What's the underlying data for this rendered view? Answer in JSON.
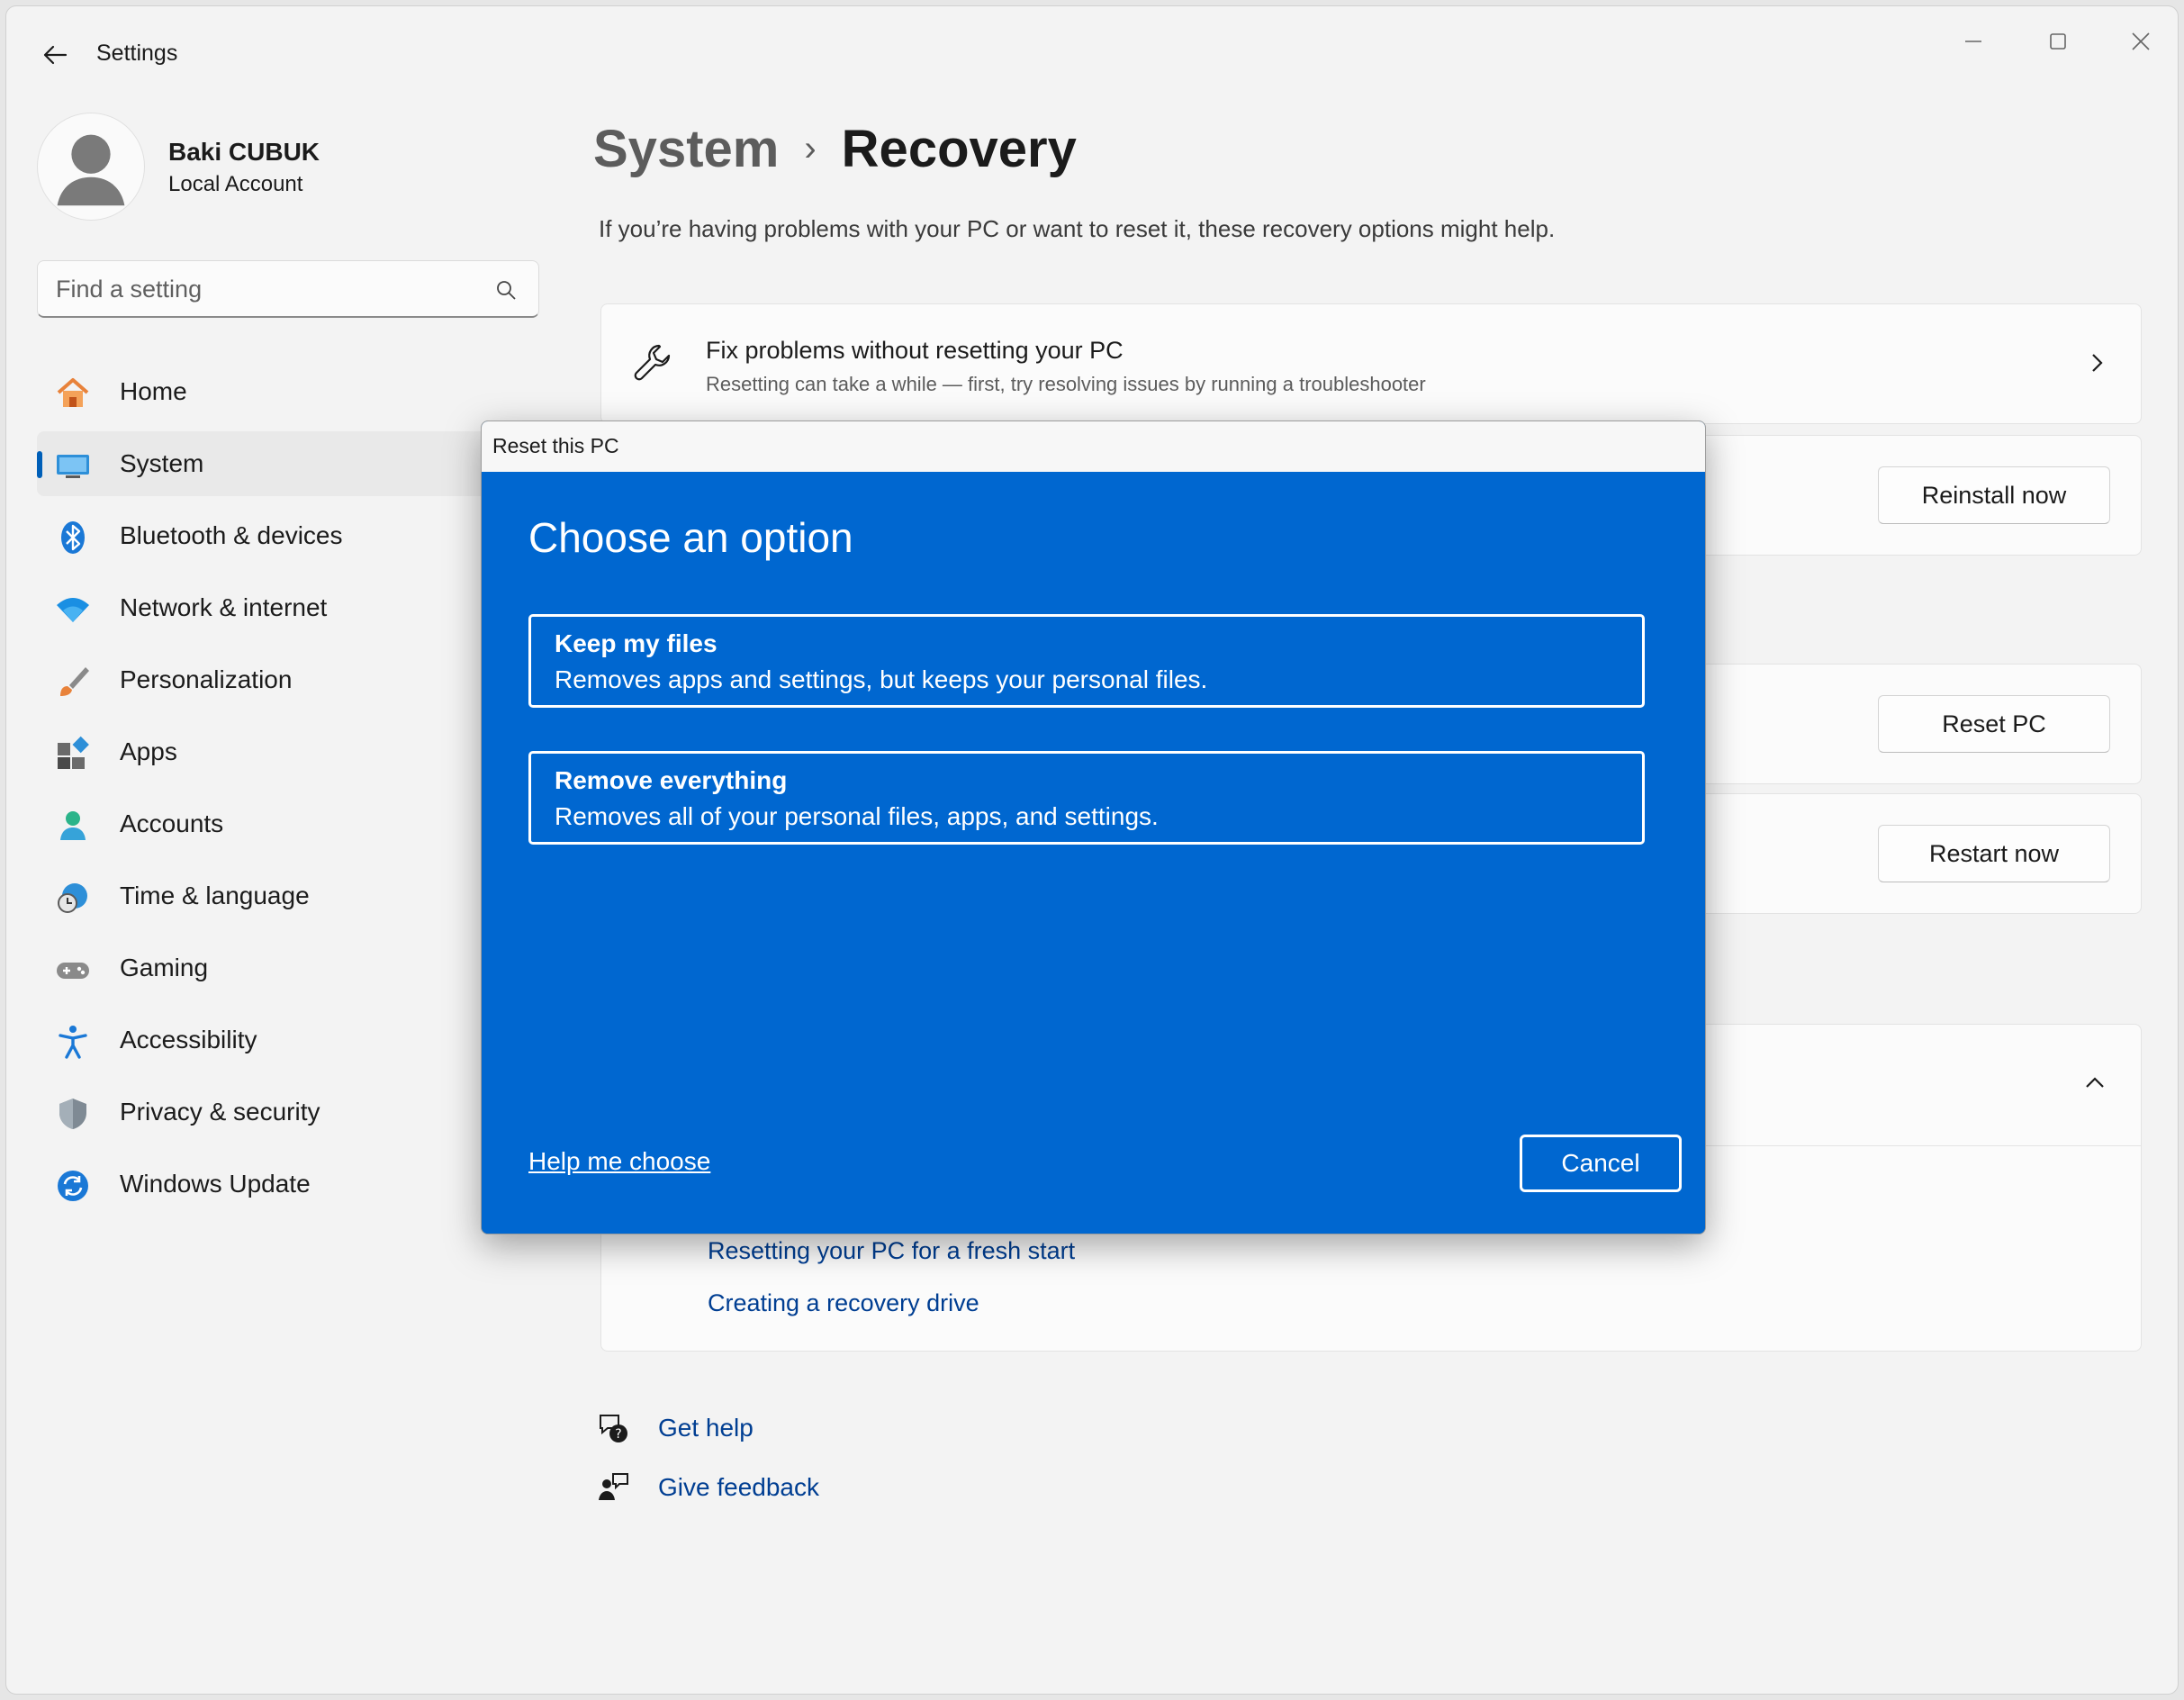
{
  "app": {
    "title": "Settings"
  },
  "profile": {
    "name": "Baki CUBUK",
    "account_type": "Local Account"
  },
  "search": {
    "placeholder": "Find a setting"
  },
  "sidebar": {
    "items": [
      {
        "label": "Home",
        "icon": "home-icon"
      },
      {
        "label": "System",
        "icon": "system-icon",
        "selected": true
      },
      {
        "label": "Bluetooth & devices",
        "icon": "bluetooth-icon"
      },
      {
        "label": "Network & internet",
        "icon": "wifi-icon"
      },
      {
        "label": "Personalization",
        "icon": "brush-icon"
      },
      {
        "label": "Apps",
        "icon": "apps-icon"
      },
      {
        "label": "Accounts",
        "icon": "accounts-icon"
      },
      {
        "label": "Time & language",
        "icon": "time-language-icon"
      },
      {
        "label": "Gaming",
        "icon": "gaming-icon"
      },
      {
        "label": "Accessibility",
        "icon": "accessibility-icon"
      },
      {
        "label": "Privacy & security",
        "icon": "shield-icon"
      },
      {
        "label": "Windows Update",
        "icon": "update-icon"
      }
    ]
  },
  "main": {
    "breadcrumb_parent": "System",
    "breadcrumb_current": "Recovery",
    "description": "If you’re having problems with your PC or want to reset it, these recovery options might help.",
    "fix_card": {
      "title": "Fix problems without resetting your PC",
      "subtitle": "Resetting can take a while — first, try resolving issues by running a troubleshooter"
    },
    "reinstall_button": "Reinstall now",
    "reset_button": "Reset PC",
    "restart_button": "Restart now",
    "related_links": [
      "Resetting your PC for a fresh start",
      "Creating a recovery drive"
    ],
    "get_help": "Get help",
    "give_feedback": "Give feedback"
  },
  "dialog": {
    "title": "Reset this PC",
    "heading": "Choose an option",
    "options": [
      {
        "title": "Keep my files",
        "description": "Removes apps and settings, but keeps your personal files."
      },
      {
        "title": "Remove everything",
        "description": "Removes all of your personal files, apps, and settings."
      }
    ],
    "help_link": "Help me choose",
    "cancel_label": "Cancel"
  },
  "colors": {
    "accent": "#005fb8",
    "dialog_blue": "#0067d0",
    "link": "#003e92"
  }
}
